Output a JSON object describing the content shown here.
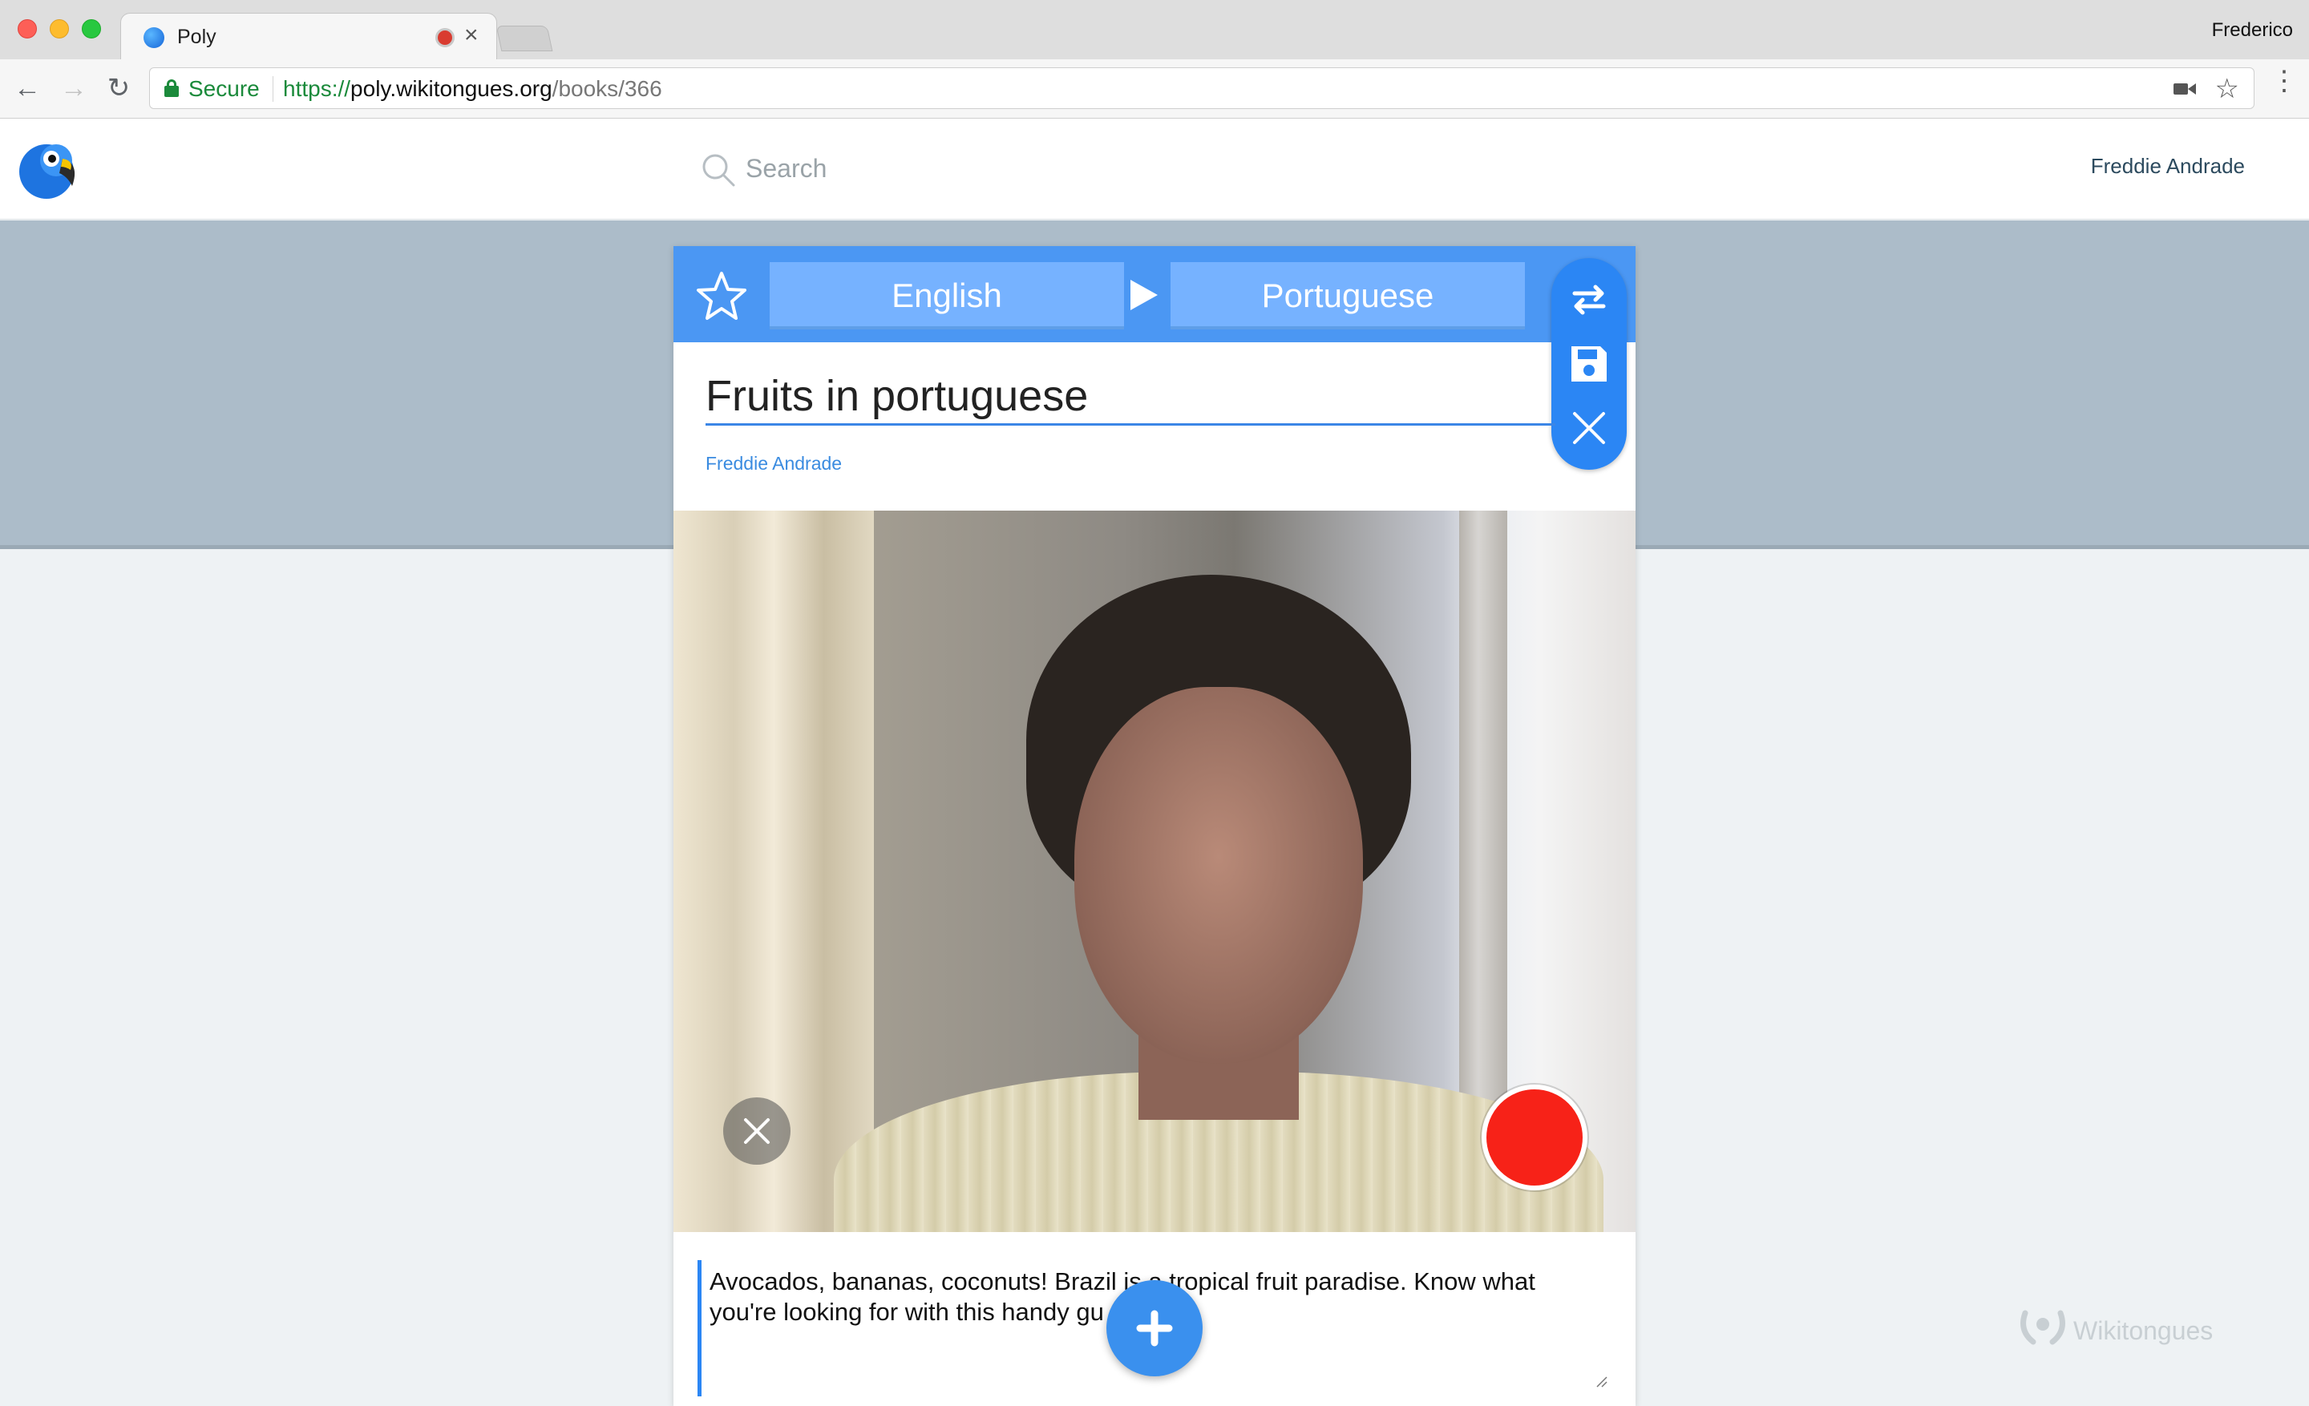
{
  "browser": {
    "tab_title": "Poly",
    "profile_name": "Frederico",
    "secure_label": "Secure",
    "url_scheme": "https://",
    "url_host": "poly.wikitongues.org",
    "url_path": "/books/366"
  },
  "header": {
    "search_placeholder": "Search",
    "user_name": "Freddie Andrade"
  },
  "book": {
    "source_language": "English",
    "target_language": "Portuguese",
    "title": "Fruits in portuguese",
    "author": "Freddie Andrade",
    "description": "Avocados, bananas, coconuts! Brazil is a tropical fruit paradise. Know what you're looking for with this handy gu"
  },
  "footer": {
    "watermark": "Wikitongues"
  },
  "colors": {
    "accent": "#4b97f3",
    "record": "#f72218",
    "band": "#acbcc9"
  }
}
